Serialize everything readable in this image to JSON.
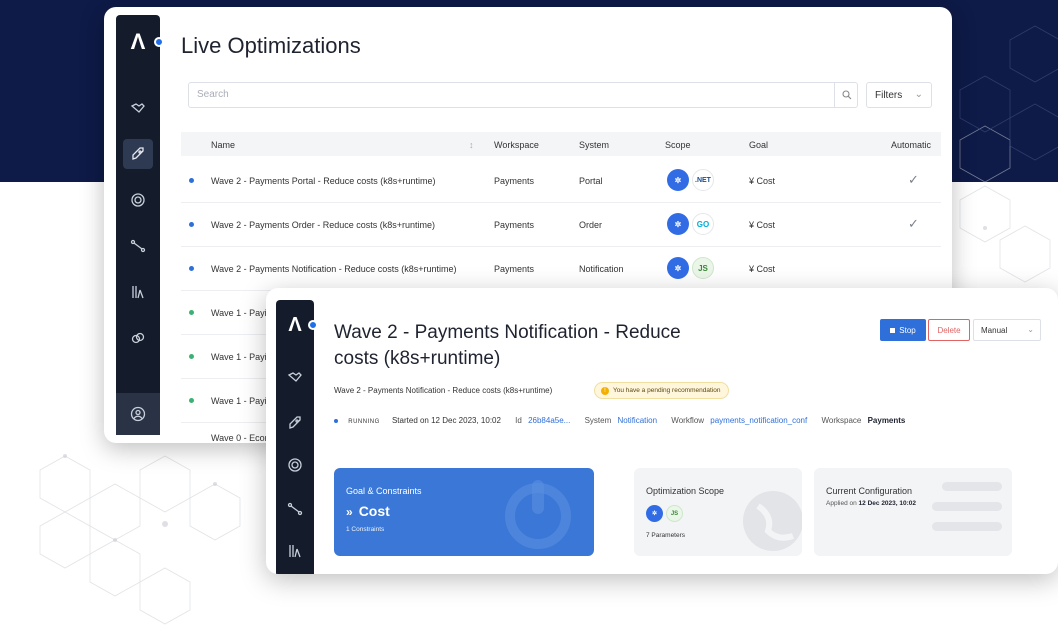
{
  "colors": {
    "background_navy": "#0e1a47",
    "accent_blue": "#2f6fd9",
    "rail": "#141c2b",
    "danger": "#e06464"
  },
  "list_view": {
    "title": "Live Optimizations",
    "search_placeholder": "Search",
    "filters_label": "Filters",
    "columns": [
      "Name",
      "Workspace",
      "System",
      "Scope",
      "Goal",
      "Automatic"
    ],
    "rows": [
      {
        "name": "Wave 2 - Payments Portal - Reduce costs (k8s+runtime)",
        "workspace": "Payments",
        "system": "Portal",
        "scope": [
          "kubernetes",
          ".NET"
        ],
        "goal": "¥ Cost",
        "automatic": true,
        "status_color": "#2f6fd9"
      },
      {
        "name": "Wave 2 - Payments Order - Reduce costs (k8s+runtime)",
        "workspace": "Payments",
        "system": "Order",
        "scope": [
          "kubernetes",
          "GO"
        ],
        "goal": "¥ Cost",
        "automatic": true,
        "status_color": "#2f6fd9"
      },
      {
        "name": "Wave 2 - Payments Notification - Reduce costs (k8s+runtime)",
        "workspace": "Payments",
        "system": "Notification",
        "scope": [
          "kubernetes",
          "JS"
        ],
        "goal": "¥ Cost",
        "automatic": false,
        "status_color": "#2f6fd9"
      },
      {
        "name": "Wave 1 - Payi",
        "status_color": "#3bb273"
      },
      {
        "name": "Wave 1 - Payi",
        "status_color": "#3bb273"
      },
      {
        "name": "Wave 1 - Payi",
        "status_color": "#3bb273"
      },
      {
        "name": "Wave 0 - Ecor",
        "status_color": "#999999"
      }
    ]
  },
  "detail_view": {
    "title": "Wave 2 - Payments Notification - Reduce costs (k8s+runtime)",
    "stop_label": "Stop",
    "delete_label": "Delete",
    "mode_value": "Manual",
    "breadcrumb": "Wave 2 - Payments Notification - Reduce costs (k8s+runtime)",
    "pending_badge": "You have a pending recommendation",
    "status": "RUNNING",
    "started": "Started on 12 Dec 2023, 10:02",
    "id_label": "Id",
    "id_value": "26b84a5e...",
    "system_label": "System",
    "system_value": "Notification",
    "workflow_label": "Workflow",
    "workflow_value": "payments_notification_conf",
    "workspace_label": "Workspace",
    "workspace_value": "Payments",
    "goal_card": {
      "heading": "Goal & Constraints",
      "value": "Cost",
      "sub": "1 Constraints"
    },
    "scope_card": {
      "heading": "Optimization Scope",
      "sub": "7 Parameters"
    },
    "config_card": {
      "heading": "Current Configuration",
      "sub_prefix": "Applied on",
      "sub_date": "12 Dec 2023, 10:02"
    }
  },
  "icons": {
    "rail": [
      "handshake-icon",
      "rocket-icon",
      "target-icon",
      "route-icon",
      "lab-icon",
      "link-icon",
      "user-icon"
    ],
    "logo": "akamas-logo"
  }
}
